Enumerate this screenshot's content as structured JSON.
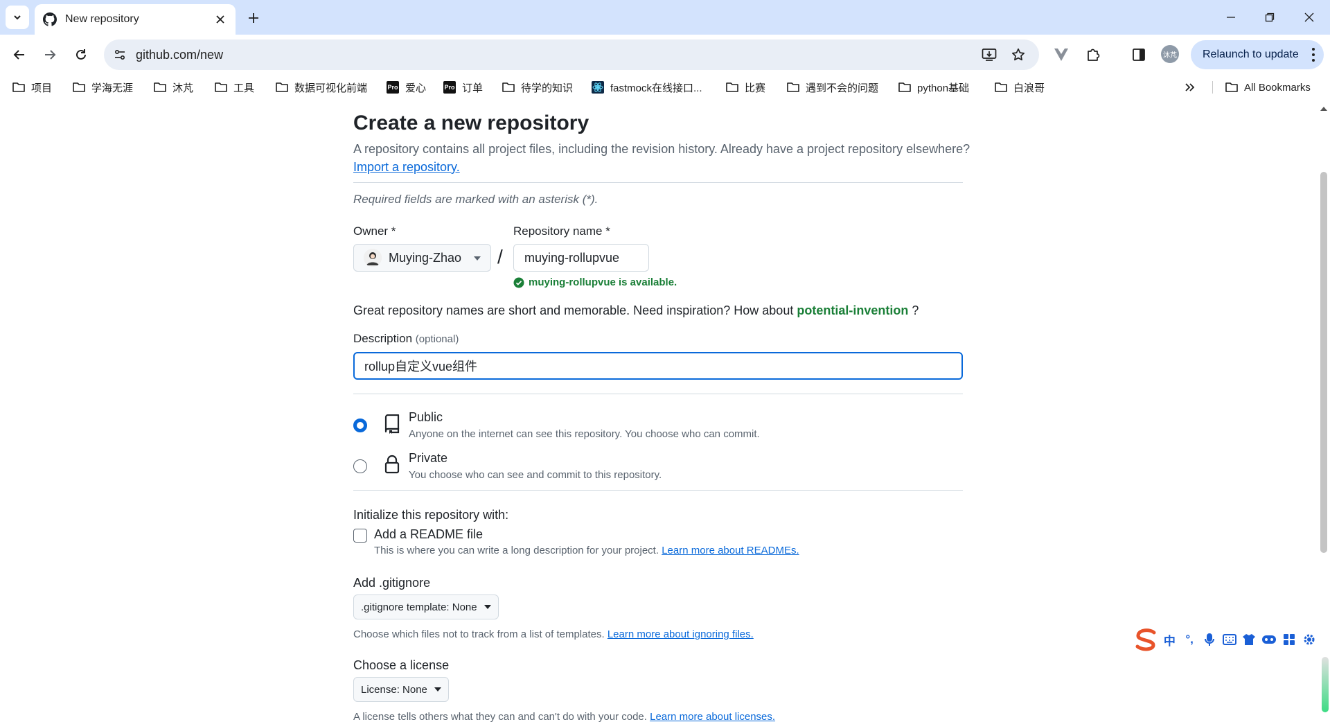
{
  "browser": {
    "tab_title": "New repository",
    "url": "github.com/new",
    "relaunch_label": "Relaunch to update",
    "profile_initials": "沐芃",
    "bookmarks": [
      {
        "label": "项目",
        "icon": "folder-icon"
      },
      {
        "label": "学海无涯",
        "icon": "folder-icon"
      },
      {
        "label": "沐芃",
        "icon": "folder-icon"
      },
      {
        "label": "工具",
        "icon": "folder-icon"
      },
      {
        "label": "数据可视化前端",
        "icon": "folder-icon"
      },
      {
        "label": "爱心",
        "icon": "pro-icon"
      },
      {
        "label": "订单",
        "icon": "pro-icon"
      },
      {
        "label": "待学的知识",
        "icon": "folder-icon"
      },
      {
        "label": "fastmock在线接口...",
        "icon": "fastmock-icon"
      },
      {
        "label": "比赛",
        "icon": "folder-icon"
      },
      {
        "label": "遇到不会的问题",
        "icon": "folder-icon"
      },
      {
        "label": "python基础",
        "icon": "folder-icon"
      },
      {
        "label": "白浪哥",
        "icon": "folder-icon"
      }
    ],
    "all_bookmarks": "All Bookmarks",
    "pro_badge": "Pro"
  },
  "page": {
    "title": "Create a new repository",
    "lead": "A repository contains all project files, including the revision history. Already have a project repository elsewhere?",
    "import_link": "Import a repository.",
    "required_note": "Required fields are marked with an asterisk (*).",
    "owner_label": "Owner *",
    "owner_value": "Muying-Zhao",
    "repo_label": "Repository name *",
    "repo_value": "muying-rollupvue",
    "slash": "/",
    "availability": "muying-rollupvue is available.",
    "inspiration_prefix": "Great repository names are short and memorable. Need inspiration? How about",
    "inspiration_suggestion": "potential-invention",
    "inspiration_suffix": " ?",
    "description_label": "Description",
    "description_optional": "(optional)",
    "description_value": "rollup自定义vue组件",
    "visibility": {
      "public_title": "Public",
      "public_desc": "Anyone on the internet can see this repository. You choose who can commit.",
      "private_title": "Private",
      "private_desc": "You choose who can see and commit to this repository.",
      "selected": "Public"
    },
    "init_title": "Initialize this repository with:",
    "readme_label": "Add a README file",
    "readme_checked": false,
    "readme_desc": "This is where you can write a long description for your project.",
    "readme_link": "Learn more about READMEs.",
    "gitignore_title": "Add .gitignore",
    "gitignore_select": ".gitignore template: None",
    "gitignore_help": "Choose which files not to track from a list of templates.",
    "gitignore_link": "Learn more about ignoring files.",
    "license_title": "Choose a license",
    "license_select": "License: None",
    "license_help": "A license tells others what they can and can't do with your code.",
    "license_link": "Learn more about licenses."
  },
  "ime": {
    "items": [
      "中",
      "°,",
      "mic-icon",
      "keyboard-icon",
      "shirt-icon",
      "gamepad-icon",
      "apps-icon",
      "settings-icon"
    ]
  },
  "colors": {
    "link": "#0969da",
    "success": "#1a7f37",
    "focus_border": "#0969da",
    "chrome_tabstrip": "#d3e3fd"
  }
}
